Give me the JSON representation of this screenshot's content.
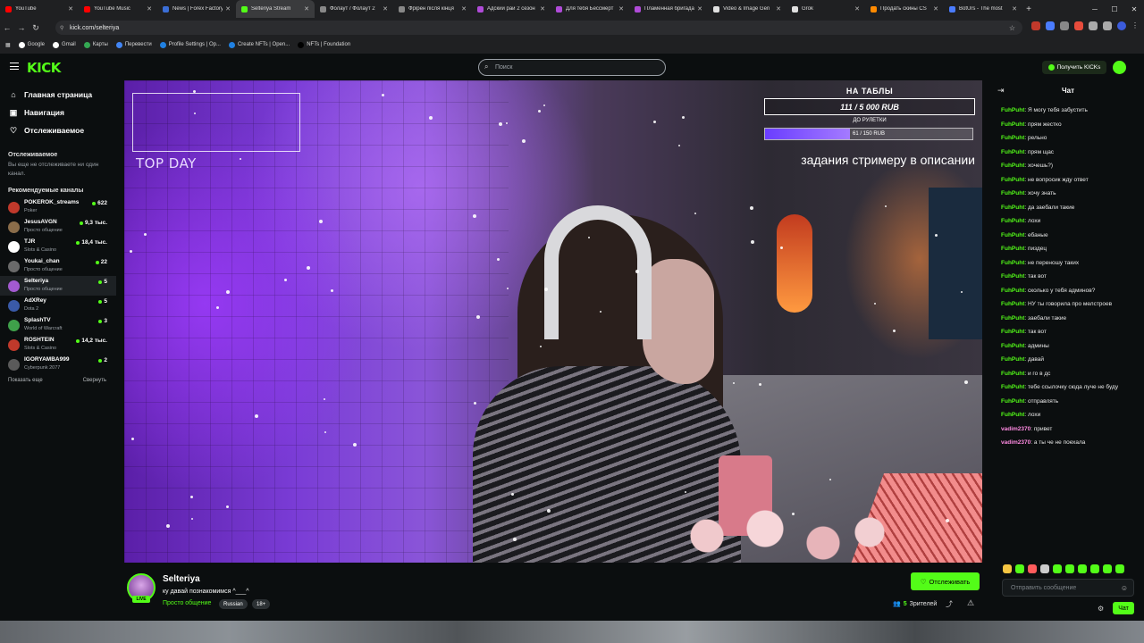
{
  "browser": {
    "tabs": [
      {
        "label": "YouTube",
        "color": "#ff0000"
      },
      {
        "label": "YouTube Music",
        "color": "#ff0000"
      },
      {
        "label": "News | Forex Factory",
        "color": "#3b6ed6"
      },
      {
        "label": "Selteriya Stream",
        "color": "#53fc18"
      },
      {
        "label": "Фолаут / Фолаут 2",
        "color": "#888888"
      },
      {
        "label": "Фрірен після кінця",
        "color": "#888888"
      },
      {
        "label": "Адский рай 2 сезон",
        "color": "#b04bd8"
      },
      {
        "label": "Для тебя Бессмерт",
        "color": "#b04bd8"
      },
      {
        "label": "Пламенная бригада",
        "color": "#b04bd8"
      },
      {
        "label": "Video & Image Gen",
        "color": "#e0e0e0"
      },
      {
        "label": "Grok",
        "color": "#e0e0e0"
      },
      {
        "label": "Продать скины CS",
        "color": "#ff8a00"
      },
      {
        "label": "BotUrs - The most",
        "color": "#4a7cff"
      }
    ],
    "address": "kick.com/selteriya",
    "bookmarks": [
      {
        "label": "Google",
        "color": "#ffffff"
      },
      {
        "label": "Gmail",
        "color": "#ffffff"
      },
      {
        "label": "Карты",
        "color": "#34a853"
      },
      {
        "label": "Перевести",
        "color": "#4285f4"
      },
      {
        "label": "Profile Settings | Op...",
        "color": "#2081e2"
      },
      {
        "label": "Create NFTs | Open...",
        "color": "#2081e2"
      },
      {
        "label": "NFTs | Foundation",
        "color": "#000000"
      }
    ]
  },
  "header": {
    "logo": "KICK",
    "search_placeholder": "Поиск",
    "get_kicks": "Получить KICKs"
  },
  "sidebar": {
    "nav": [
      {
        "label": "Главная страница",
        "icon": "home-icon",
        "glyph": "⌂"
      },
      {
        "label": "Навигация",
        "icon": "browse-icon",
        "glyph": "▣"
      },
      {
        "label": "Отслеживаемое",
        "icon": "heart-icon",
        "glyph": "♡"
      }
    ],
    "following_title": "Отслеживаемое",
    "following_note": "Вы еще не отслеживаете ни один канал.",
    "recommended_title": "Рекомендуемые каналы",
    "channels": [
      {
        "name": "POKEROK_streams",
        "category": "Poker",
        "viewers": "622",
        "color": "#c0392b"
      },
      {
        "name": "JesusAVGN",
        "category": "Просто общение",
        "viewers": "9,3 тыс.",
        "color": "#8a6d4a"
      },
      {
        "name": "TJR",
        "category": "Slots & Casino",
        "viewers": "18,4 тыс.",
        "color": "#ffffff"
      },
      {
        "name": "Youkai_chan",
        "category": "Просто общение",
        "viewers": "22",
        "color": "#6a6a6a"
      },
      {
        "name": "Selteriya",
        "category": "Просто общение",
        "viewers": "5",
        "color": "#a35ad1"
      },
      {
        "name": "AdXRey",
        "category": "Dota 2",
        "viewers": "5",
        "color": "#3a5aa8"
      },
      {
        "name": "SplashTV",
        "category": "World of Warcraft",
        "viewers": "3",
        "color": "#3fa04a"
      },
      {
        "name": "ROSHTEIN",
        "category": "Slots & Casino",
        "viewers": "14,2 тыс.",
        "color": "#c0392b"
      },
      {
        "name": "IGORYAMBA999",
        "category": "Cyberpunk 2077",
        "viewers": "2",
        "color": "#5a5a5a"
      }
    ],
    "show_more": "Показать еще",
    "collapse": "Свернуть"
  },
  "stream_overlay": {
    "top_day": "TOP DAY",
    "donation_title": "НА ТАБЛЫ",
    "donation_value": "111 / 5 000 RUB",
    "roulette_label": "ДО РУЛЕТКИ",
    "roulette_value": "61 / 150 RUB",
    "roulette_progress": 0.41,
    "tasks_text": "задания стримеру в описании"
  },
  "stream_info": {
    "streamer": "Selteriya",
    "live_badge": "LIVE",
    "title": "ку давай познакомимся ^___^",
    "category": "Просто общение",
    "tags": [
      "Russian",
      "18+"
    ],
    "follow_button": "Отслеживать",
    "viewers_count": "5",
    "viewers_label": "Зрителей"
  },
  "chat": {
    "title": "Чат",
    "messages": [
      {
        "user": "FuhPuht",
        "text": "Я могу тебя забустить"
      },
      {
        "user": "FuhPuht",
        "text": "прям жестко"
      },
      {
        "user": "FuhPuht",
        "text": "рельно"
      },
      {
        "user": "FuhPuht",
        "text": "прям щас"
      },
      {
        "user": "FuhPuht",
        "text": "хочешь?)"
      },
      {
        "user": "FuhPuht",
        "text": "не вопросик жду ответ"
      },
      {
        "user": "FuhPuht",
        "text": "хочу знать"
      },
      {
        "user": "FuhPuht",
        "text": "да заебали такие"
      },
      {
        "user": "FuhPuht",
        "text": "лохи"
      },
      {
        "user": "FuhPuht",
        "text": "ебаные"
      },
      {
        "user": "FuhPuht",
        "text": "пиздец"
      },
      {
        "user": "FuhPuht",
        "text": "не переношу таких"
      },
      {
        "user": "FuhPuht",
        "text": "так вот"
      },
      {
        "user": "FuhPuht",
        "text": "сколько у тебя админов?"
      },
      {
        "user": "FuhPuht",
        "text": "НУ ты говорила про мелстроев"
      },
      {
        "user": "FuhPuht",
        "text": "заебали такие"
      },
      {
        "user": "FuhPuht",
        "text": "так вот"
      },
      {
        "user": "FuhPuht",
        "text": "админы"
      },
      {
        "user": "FuhPuht",
        "text": "давай"
      },
      {
        "user": "FuhPuht",
        "text": "и го в дс"
      },
      {
        "user": "FuhPuht",
        "text": "тебе ссылочку сюда луче не буду"
      },
      {
        "user": "FuhPuht",
        "text": "отправлять"
      },
      {
        "user": "FuhPuht",
        "text": "лохи"
      },
      {
        "user": "vadim2370",
        "text": "привет"
      },
      {
        "user": "vadim2370",
        "text": "а ты че не поехала"
      }
    ],
    "emote_colors": [
      "#f5c542",
      "#53fc18",
      "#ff5c5c",
      "#cccccc",
      "#53fc18",
      "#53fc18",
      "#53fc18",
      "#53fc18",
      "#53fc18",
      "#53fc18"
    ],
    "input_placeholder": "Отправить сообщение",
    "send_button": "Чат"
  }
}
